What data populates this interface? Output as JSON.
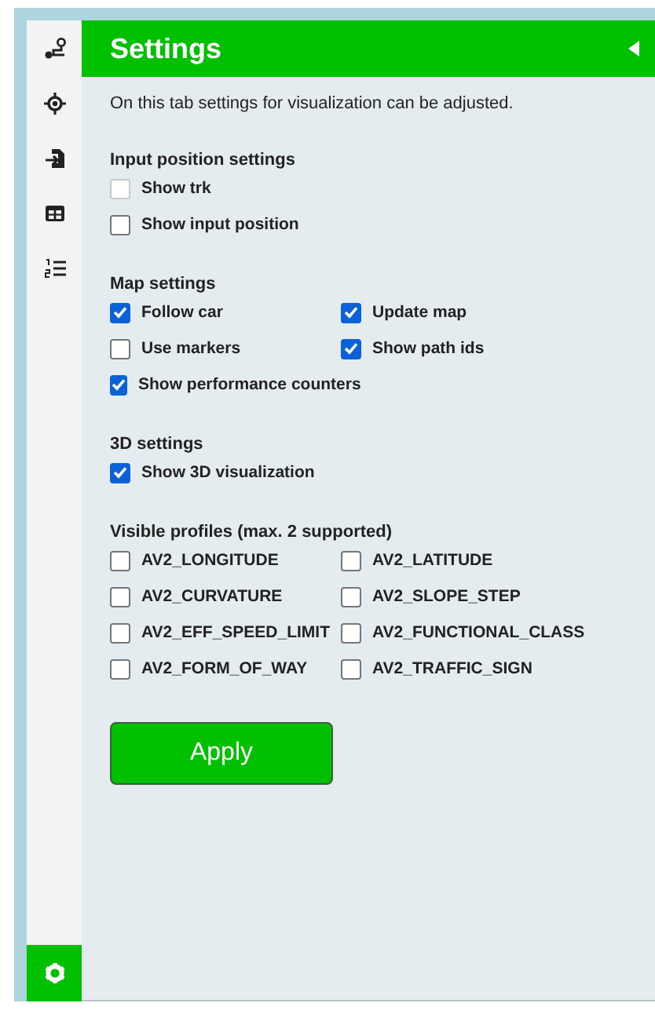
{
  "sidebar": {
    "tabs": [
      {
        "selected": false
      },
      {
        "selected": false
      },
      {
        "selected": false
      },
      {
        "selected": false
      },
      {
        "selected": false
      },
      {
        "selected": true
      }
    ]
  },
  "header": {
    "title": "Settings"
  },
  "description": "On this tab settings for visualization can be adjusted.",
  "sections": [
    {
      "title": "Input position settings",
      "kind": "list",
      "options": [
        {
          "label": "Show trk",
          "checked": false,
          "disabled": true
        },
        {
          "label": "Show input position",
          "checked": false,
          "disabled": false
        }
      ]
    },
    {
      "title": "Map settings",
      "kind": "grid",
      "options": [
        {
          "label": "Follow car",
          "checked": true,
          "disabled": false
        },
        {
          "label": "Update map",
          "checked": true,
          "disabled": false
        },
        {
          "label": "Use markers",
          "checked": false,
          "disabled": false
        },
        {
          "label": "Show path ids",
          "checked": true,
          "disabled": false
        },
        {
          "label": "Show performance counters",
          "checked": true,
          "disabled": false
        }
      ]
    },
    {
      "title": "3D settings",
      "kind": "list",
      "options": [
        {
          "label": "Show 3D visualization",
          "checked": true,
          "disabled": false
        }
      ]
    },
    {
      "title": "Visible profiles (max. 2 supported)",
      "kind": "grid",
      "options": [
        {
          "label": "AV2_LONGITUDE",
          "checked": false,
          "disabled": false
        },
        {
          "label": "AV2_LATITUDE",
          "checked": false,
          "disabled": false
        },
        {
          "label": "AV2_CURVATURE",
          "checked": false,
          "disabled": false
        },
        {
          "label": "AV2_SLOPE_STEP",
          "checked": false,
          "disabled": false
        },
        {
          "label": "AV2_EFF_SPEED_LIMIT",
          "checked": false,
          "disabled": false
        },
        {
          "label": "AV2_FUNCTIONAL_CLASS",
          "checked": false,
          "disabled": false
        },
        {
          "label": "AV2_FORM_OF_WAY",
          "checked": false,
          "disabled": false
        },
        {
          "label": "AV2_TRAFFIC_SIGN",
          "checked": false,
          "disabled": false
        }
      ]
    }
  ],
  "apply_button": {
    "label": "Apply"
  }
}
